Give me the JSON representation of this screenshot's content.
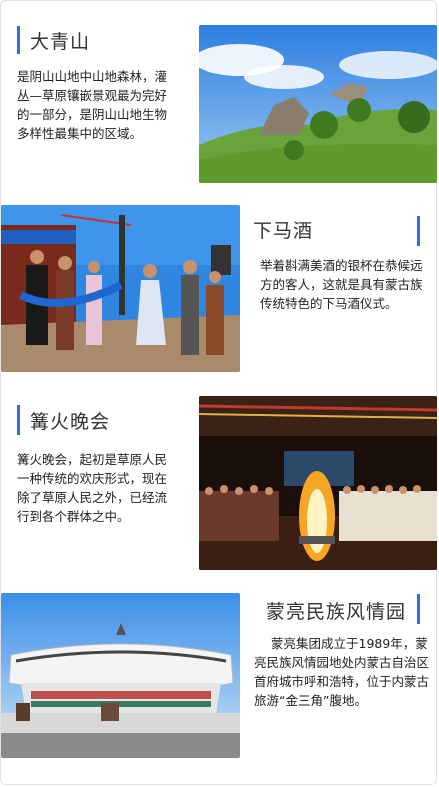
{
  "sections": [
    {
      "title": "大青山",
      "description": "是阴山山地中山地森林，灌丛—草原镶嵌景观最为完好的一部分，是阴山山地生物多样性最集中的区域。",
      "photo_icon": "mountain-landscape-photo"
    },
    {
      "title": "下马酒",
      "description": "举着斟满美酒的银杯在恭候远方的客人，这就是具有蒙古族传统特色的下马酒仪式。",
      "photo_icon": "welcome-ceremony-photo"
    },
    {
      "title": "篝火晚会",
      "description": "篝火晚会，起初是草原人民一种传统的欢庆形式，现在除了草原人民之外，已经流行到各个群体之中。",
      "photo_icon": "bonfire-party-photo"
    },
    {
      "title": "蒙亮民族风情园",
      "description": "蒙亮集团成立于1989年，蒙亮民族风情园地处内蒙古自治区首府城市呼和浩特，位于内蒙古旅游“金三角”腹地。",
      "photo_icon": "folk-park-building-photo"
    }
  ],
  "colors": {
    "accent": "#2f6fd6",
    "text": "#222222"
  }
}
